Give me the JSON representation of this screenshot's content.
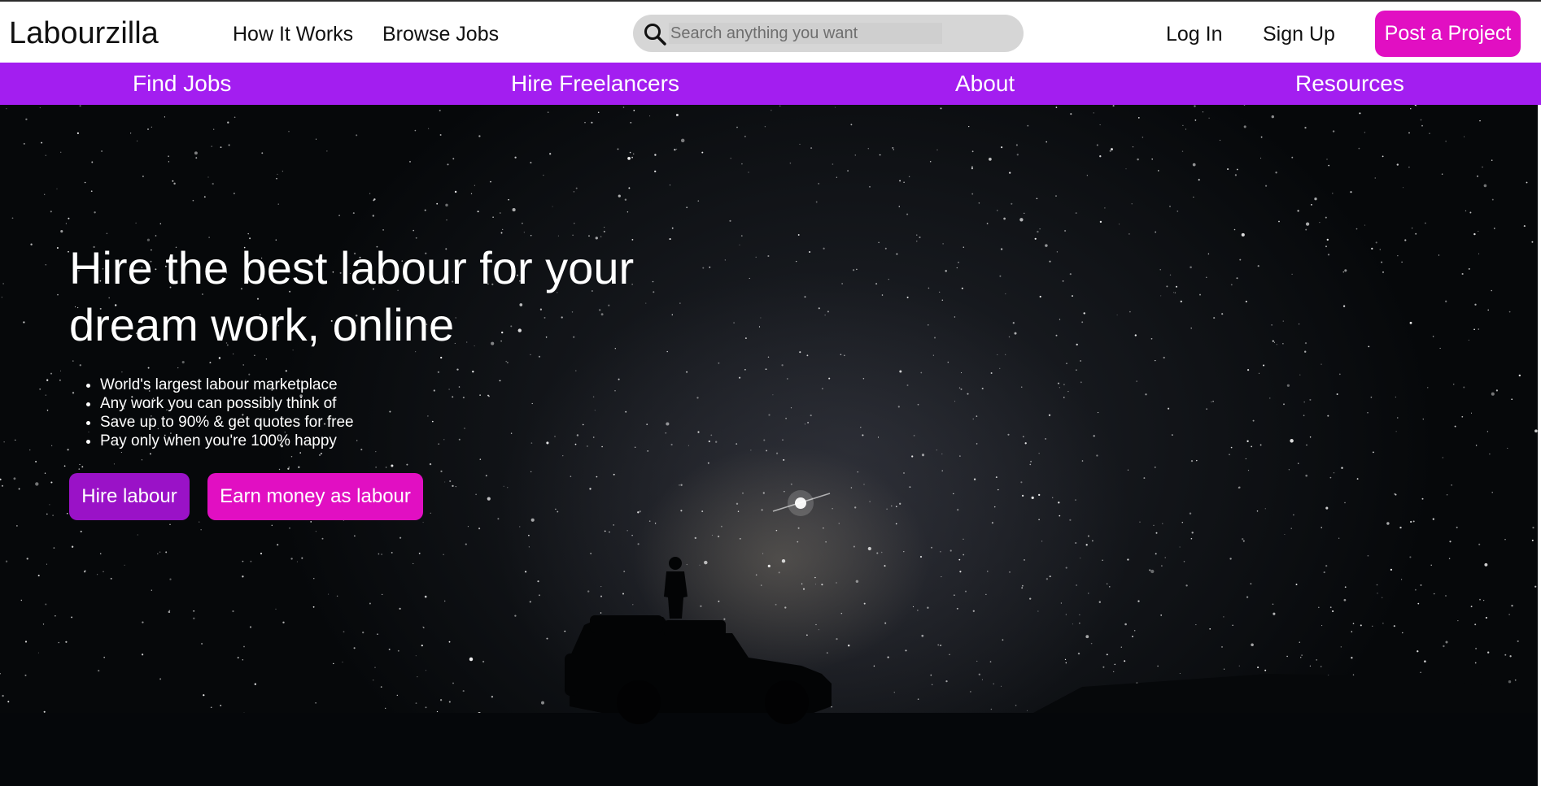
{
  "header": {
    "logo": "Labourzilla",
    "nav_links": [
      "How It Works",
      "Browse Jobs"
    ],
    "search": {
      "placeholder": "Search anything you want",
      "icon": "search-icon"
    },
    "login_label": "Log In",
    "signup_label": "Sign Up",
    "post_project_label": "Post a Project"
  },
  "category_nav": {
    "items": [
      "Find Jobs",
      "Hire Freelancers",
      "About",
      "Resources"
    ]
  },
  "hero": {
    "title": "Hire the best labour for your dream work, online",
    "bullets": [
      "World's largest labour marketplace",
      "Any work you can possibly think of",
      "Save up to 90% & get quotes for free",
      "Pay only when you're 100% happy"
    ],
    "primary_button": "Hire labour",
    "secondary_button": "Earn money as labour",
    "background": "starry-night-sky-with-jeep-silhouette"
  },
  "colors": {
    "brand_purple": "#a31ef0",
    "accent_magenta": "#e10fc2",
    "hire_button": "#9a12c7",
    "search_bg": "#d6d6d6"
  }
}
